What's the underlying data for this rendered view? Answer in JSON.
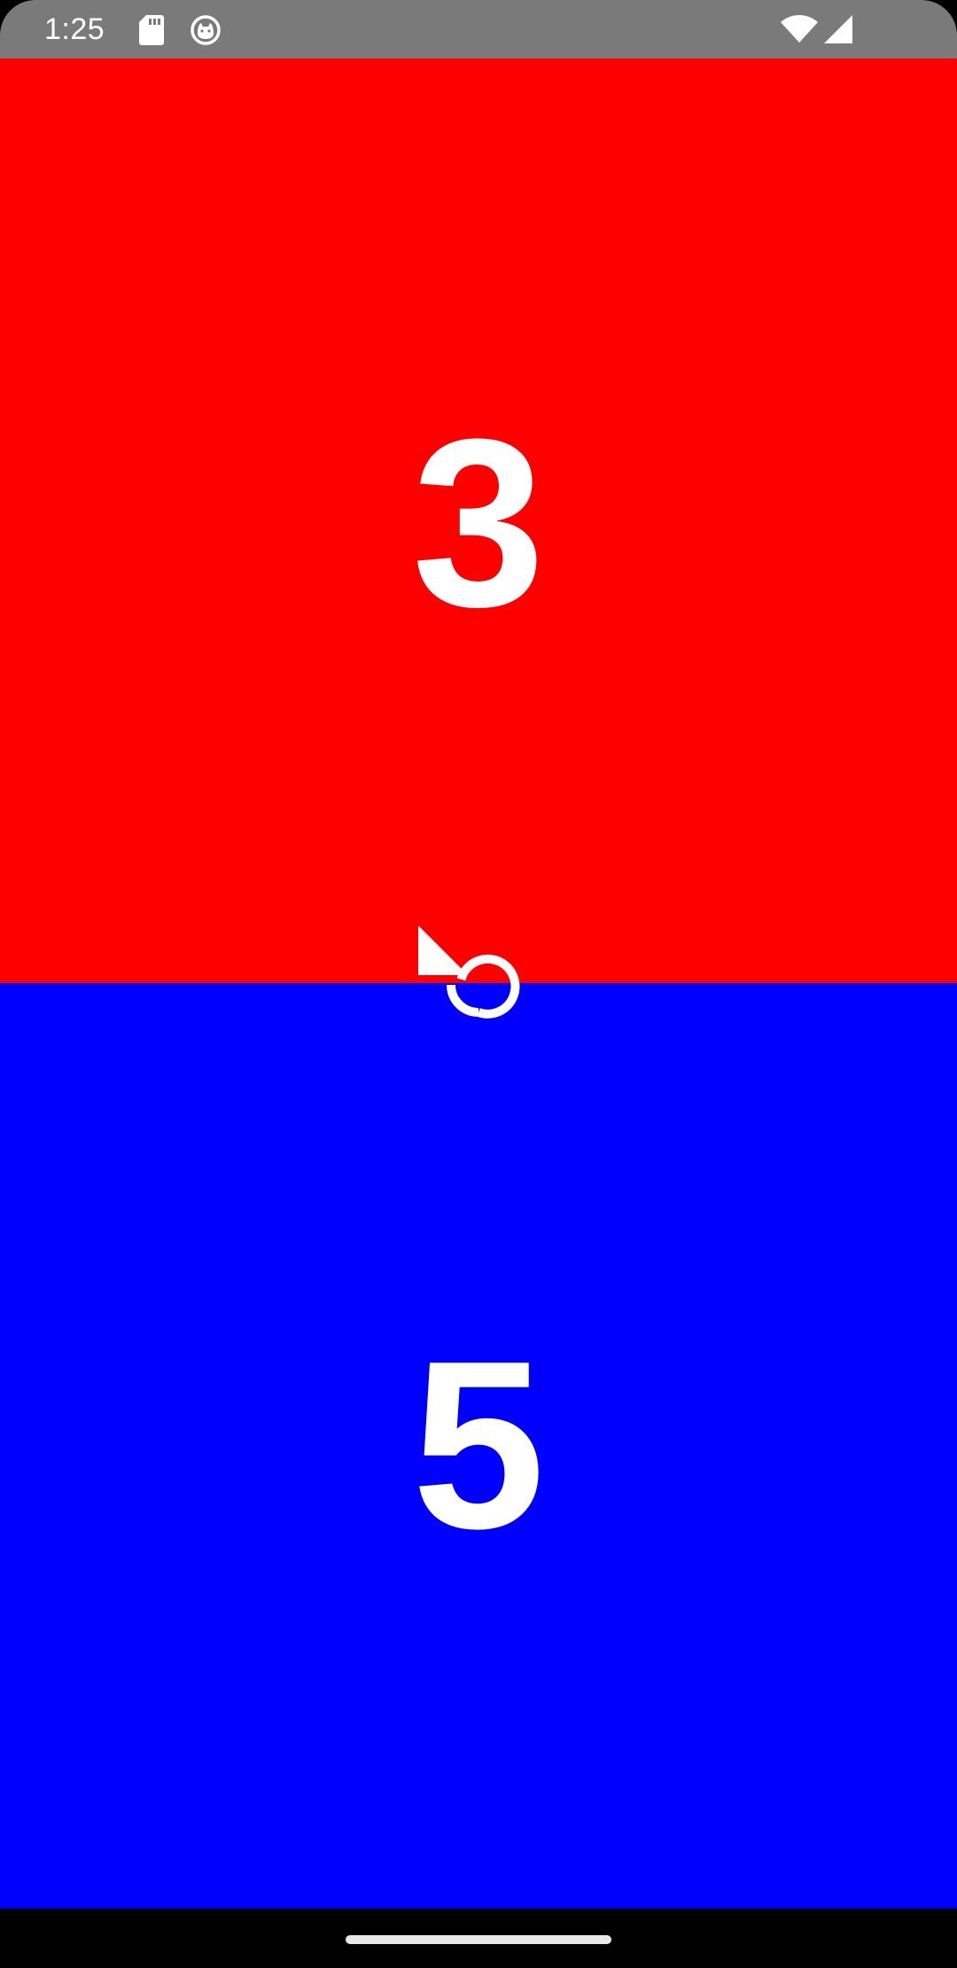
{
  "status_bar": {
    "time": "1:25",
    "icons": [
      "sd-card-icon",
      "cat-face-icon",
      "wifi-icon",
      "cellular-signal-icon"
    ],
    "background": "#7a7a7a"
  },
  "players": [
    {
      "id": "player-1",
      "score": "3",
      "color": "#ff0000"
    },
    {
      "id": "player-2",
      "score": "5",
      "color": "#0000ff"
    }
  ],
  "controls": {
    "reset_icon": "reset-icon"
  },
  "nav_bar": {
    "home_handle": "home-handle"
  }
}
